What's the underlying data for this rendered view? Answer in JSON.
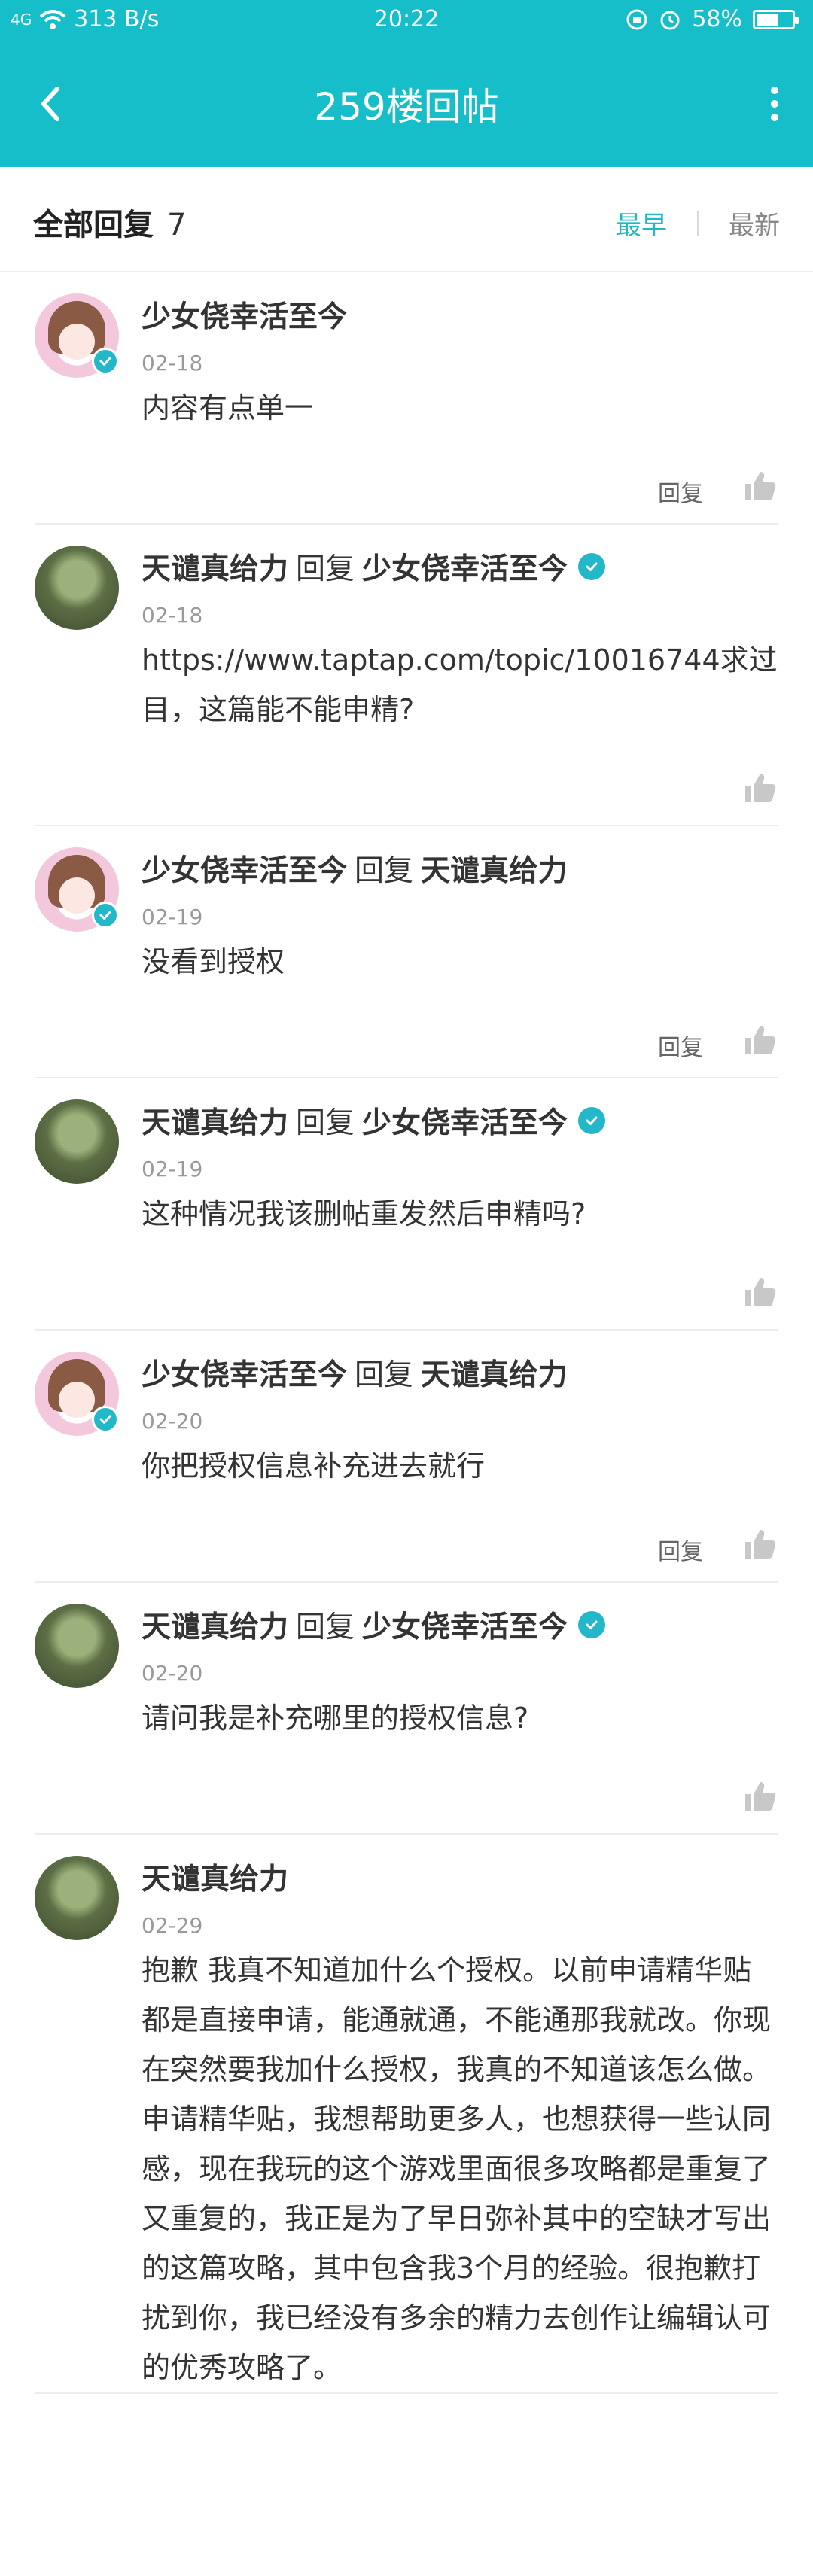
{
  "status": {
    "signal": "4G",
    "net_speed": "313 B/s",
    "time": "20:22",
    "battery": "58%",
    "battery_level": 0.58
  },
  "nav": {
    "title": "259楼回帖"
  },
  "filter": {
    "label": "全部回复",
    "count": "7",
    "sort_earliest": "最早",
    "sort_latest": "最新"
  },
  "common": {
    "reply_word": "回复",
    "reply_action": "回复"
  },
  "posts": [
    {
      "author": "少女侥幸活至今",
      "reply_to": "",
      "date": "02-18",
      "text": "内容有点单一",
      "avatar": "girl",
      "show_reply": true
    },
    {
      "author": "天谴真给力",
      "reply_to": "少女侥幸活至今",
      "date": "02-18",
      "text": "https://www.taptap.com/topic/10016744求过目，这篇能不能申精?",
      "avatar": "tree",
      "show_reply": false
    },
    {
      "author": "少女侥幸活至今",
      "reply_to": "天谴真给力",
      "date": "02-19",
      "text": "没看到授权",
      "avatar": "girl",
      "show_reply": true
    },
    {
      "author": "天谴真给力",
      "reply_to": "少女侥幸活至今",
      "date": "02-19",
      "text": "这种情况我该删帖重发然后申精吗?",
      "avatar": "tree",
      "show_reply": false
    },
    {
      "author": "少女侥幸活至今",
      "reply_to": "天谴真给力",
      "date": "02-20",
      "text": "你把授权信息补充进去就行",
      "avatar": "girl",
      "show_reply": true
    },
    {
      "author": "天谴真给力",
      "reply_to": "少女侥幸活至今",
      "date": "02-20",
      "text": "请问我是补充哪里的授权信息?",
      "avatar": "tree",
      "show_reply": false
    },
    {
      "author": "天谴真给力",
      "reply_to": "",
      "date": "02-29",
      "text": "抱歉 我真不知道加什么个授权。以前申请精华贴都是直接申请，能通就通，不能通那我就改。你现在突然要我加什么授权，我真的不知道该怎么做。申请精华贴，我想帮助更多人，也想获得一些认同感，现在我玩的这个游戏里面很多攻略都是重复了又重复的，我正是为了早日弥补其中的空缺才写出的这篇攻略，其中包含我3个月的经验。很抱歉打扰到你，我已经没有多余的精力去创作让编辑认可的优秀攻略了。",
      "avatar": "tree",
      "show_reply": false
    }
  ]
}
